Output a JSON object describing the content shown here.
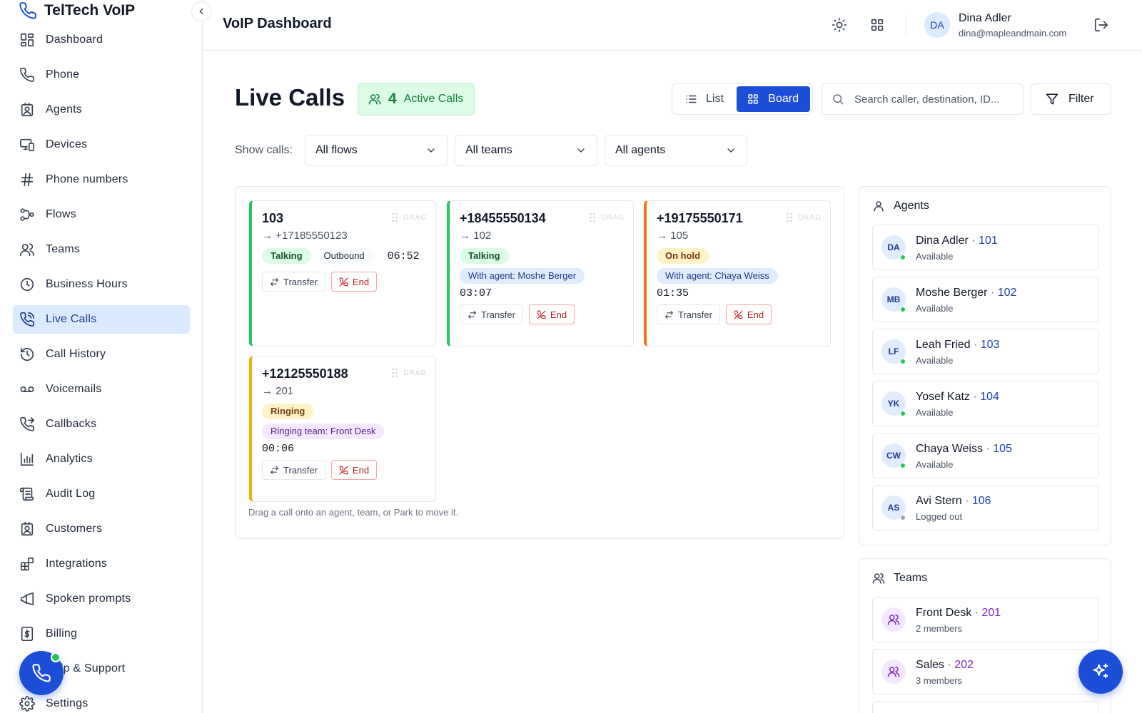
{
  "brand": {
    "name": "TelTech VoIP",
    "icon": "phone-icon"
  },
  "nav": [
    {
      "label": "Dashboard",
      "icon": "grid-icon"
    },
    {
      "label": "Phone",
      "icon": "phone-icon"
    },
    {
      "label": "Agents",
      "icon": "id-badge-icon"
    },
    {
      "label": "Devices",
      "icon": "devices-icon"
    },
    {
      "label": "Phone numbers",
      "icon": "hash-icon"
    },
    {
      "label": "Flows",
      "icon": "flow-icon"
    },
    {
      "label": "Teams",
      "icon": "users-icon"
    },
    {
      "label": "Business Hours",
      "icon": "clock-icon"
    },
    {
      "label": "Live Calls",
      "icon": "phone-call-icon",
      "active": true
    },
    {
      "label": "Call History",
      "icon": "history-icon"
    },
    {
      "label": "Voicemails",
      "icon": "voicemail-icon"
    },
    {
      "label": "Callbacks",
      "icon": "phone-forward-icon"
    },
    {
      "label": "Analytics",
      "icon": "bar-chart-icon"
    },
    {
      "label": "Audit Log",
      "icon": "scroll-icon"
    },
    {
      "label": "Customers",
      "icon": "contact-icon"
    },
    {
      "label": "Integrations",
      "icon": "blocks-icon"
    },
    {
      "label": "Spoken prompts",
      "icon": "megaphone-icon"
    },
    {
      "label": "Billing",
      "icon": "dollar-file-icon"
    },
    {
      "label": "Help & Support",
      "icon": "help-icon"
    },
    {
      "label": "Settings",
      "icon": "gear-icon"
    }
  ],
  "header": {
    "title": "VoIP Dashboard",
    "user": {
      "initials": "DA",
      "name": "Dina Adler",
      "email": "dina@mapleandmain.com"
    }
  },
  "main": {
    "title": "Live Calls",
    "active_count": "4",
    "active_label": "Active Calls",
    "view_list": "List",
    "view_board": "Board",
    "search_placeholder": "Search caller, destination, ID...",
    "filter_label": "Filter",
    "show_label": "Show calls:",
    "filters": [
      "All flows",
      "All teams",
      "All agents"
    ],
    "drag_label": "DRAG",
    "board_hint": "Drag a call onto an agent, team, or Park to move it."
  },
  "calls": [
    {
      "number": "103",
      "destination": "→ +17185550123",
      "status": "Talking",
      "direction": "Outbound",
      "timer": "06:52",
      "transfer": "Transfer",
      "end": "End",
      "accent": "#22c55e"
    },
    {
      "number": "+18455550134",
      "destination": "→ 102",
      "status": "Talking",
      "target": "With agent: Moshe Berger",
      "timer": "03:07",
      "transfer": "Transfer",
      "end": "End",
      "accent": "#22c55e"
    },
    {
      "number": "+19175550171",
      "destination": "→ 105",
      "status": "On hold",
      "target": "With agent: Chaya Weiss",
      "timer": "01:35",
      "transfer": "Transfer",
      "end": "End",
      "accent": "#f97316"
    },
    {
      "number": "+12125550188",
      "destination": "→ 201",
      "status": "Ringing",
      "target": "Ringing team: Front Desk",
      "timer": "00:06",
      "transfer": "Transfer",
      "end": "End",
      "accent": "#eab308"
    }
  ],
  "agents_panel": {
    "title": "Agents",
    "items": [
      {
        "initials": "DA",
        "name": "Dina Adler",
        "ext": "101",
        "status": "Available"
      },
      {
        "initials": "MB",
        "name": "Moshe Berger",
        "ext": "102",
        "status": "Available"
      },
      {
        "initials": "LF",
        "name": "Leah Fried",
        "ext": "103",
        "status": "Available"
      },
      {
        "initials": "YK",
        "name": "Yosef Katz",
        "ext": "104",
        "status": "Available"
      },
      {
        "initials": "CW",
        "name": "Chaya Weiss",
        "ext": "105",
        "status": "Available"
      },
      {
        "initials": "AS",
        "name": "Avi Stern",
        "ext": "106",
        "status": "Logged out"
      }
    ]
  },
  "teams_panel": {
    "title": "Teams",
    "items": [
      {
        "name": "Front Desk",
        "ext": "201",
        "members": "2 members"
      },
      {
        "name": "Sales",
        "ext": "202",
        "members": "3 members"
      }
    ]
  },
  "colors": {
    "accent": "#1d4ed8",
    "active_nav": "#dbeafe",
    "success": "#22c55e",
    "warning": "#f97316",
    "ringing": "#eab308"
  }
}
